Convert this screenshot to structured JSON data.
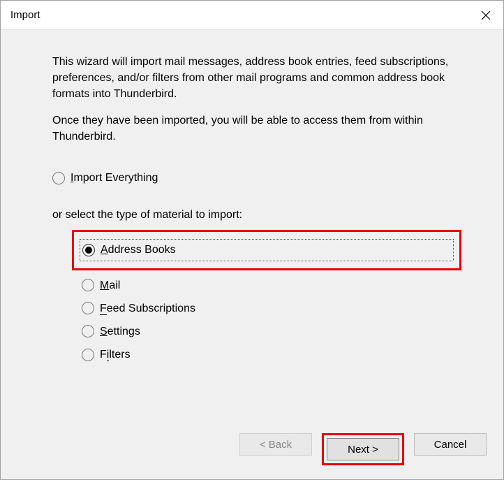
{
  "window": {
    "title": "Import"
  },
  "body": {
    "paragraph1": "This wizard will import mail messages, address book entries, feed subscriptions, preferences, and/or filters from other mail programs and common address book formats into Thunderbird.",
    "paragraph2": "Once they have been imported, you will be able to access them from within Thunderbird.",
    "importEverythingLabel": "Import Everything",
    "selectTypeLabel": "or select the type of material to import:",
    "options": {
      "addressBooks": "Address Books",
      "mail": "Mail",
      "feedSubscriptions": "Feed Subscriptions",
      "settings": "Settings",
      "filters": "Filters"
    }
  },
  "footer": {
    "back": "< Back",
    "next": "Next >",
    "cancel": "Cancel"
  }
}
